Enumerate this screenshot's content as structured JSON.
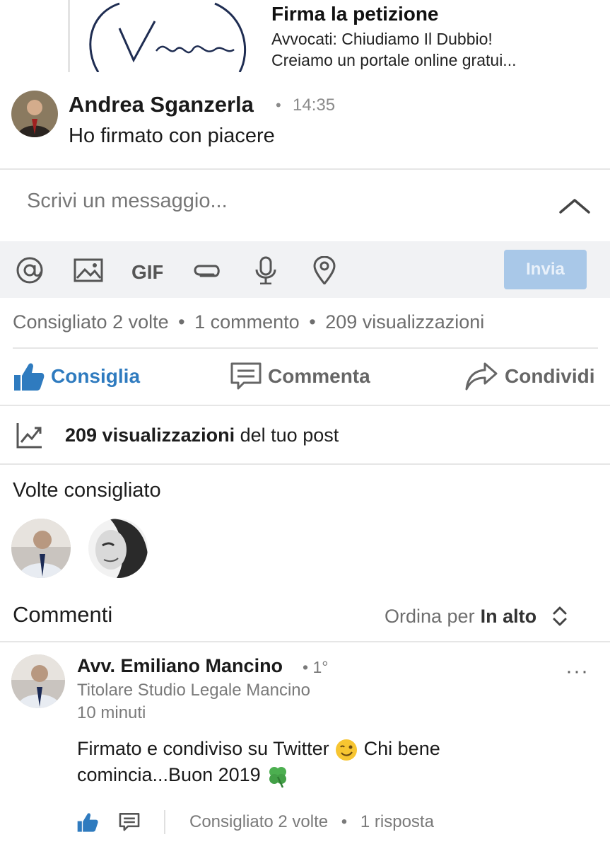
{
  "petition": {
    "title": "Firma la petizione",
    "desc_line1": "Avvocati: Chiudiamo Il Dubbio!",
    "desc_line2": "Creiamo un portale online gratui..."
  },
  "message": {
    "author": "Andrea Sganzerla",
    "separator": "•",
    "time": "14:35",
    "text": "Ho firmato con piacere"
  },
  "composer": {
    "placeholder": "Scrivi un messaggio...",
    "send_label": "Invia",
    "toolbar_icons": [
      "at-icon",
      "image-icon",
      "gif-icon",
      "attachment-icon",
      "microphone-icon",
      "location-icon"
    ]
  },
  "stats": {
    "recommended": "Consigliato 2 volte",
    "comments": "1 commento",
    "views": "209 visualizzazioni",
    "separator": "•"
  },
  "actions": {
    "like": "Consiglia",
    "comment": "Commenta",
    "share": "Condividi"
  },
  "views_row": {
    "count": "209 visualizzazioni",
    "suffix": "del tuo post"
  },
  "likes": {
    "title": "Volte consigliato"
  },
  "comments_section": {
    "title": "Commenti",
    "sort_prefix": "Ordina per",
    "sort_value": "In alto",
    "items": [
      {
        "author": "Avv. Emiliano Mancino",
        "degree": "• 1°",
        "title": "Titolare Studio Legale Mancino",
        "time": "10 minuti",
        "text_part1": "Firmato e condiviso su Twitter",
        "text_part2": "Chi bene",
        "text_part3": "comincia...Buon 2019",
        "recommended": "Consigliato 2 volte",
        "separator": "•",
        "replies": "1 risposta"
      }
    ]
  },
  "colors": {
    "accent": "#2f7bbf",
    "send_disabled": "#a9c8e8",
    "toolbar_bg": "#f1f2f4",
    "muted_text": "#6e6e6e"
  }
}
